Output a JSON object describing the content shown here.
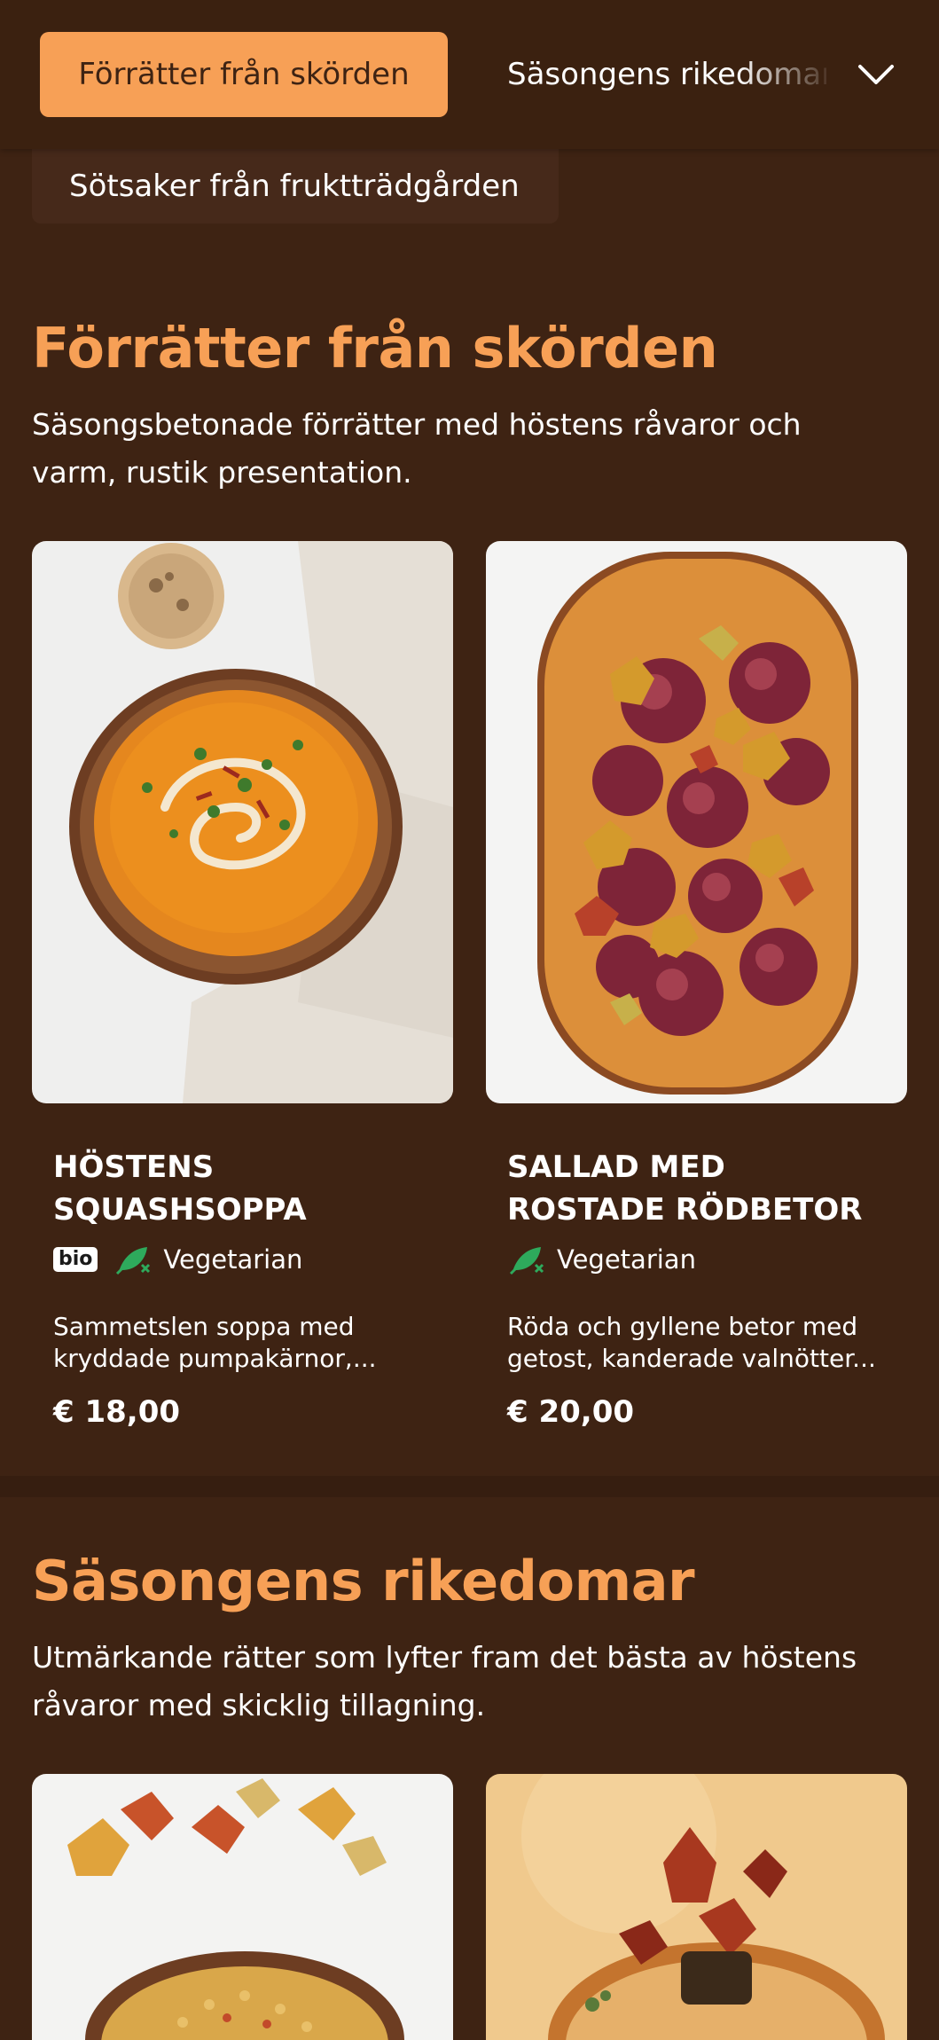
{
  "nav": {
    "active_tab": "Förrätter från skörden",
    "next_tab": "Säsongens rikedomar",
    "extra_chip": "Sötsaker från fruktträdgården"
  },
  "sections": [
    {
      "title": "Förrätter från skörden",
      "description": "Säsongsbetonade förrätter med höstens råvaror och varm, rustik presentation.",
      "items": [
        {
          "name": "HÖSTENS SQUASHSOPPA",
          "bio": "bio",
          "diet": "Vegetarian",
          "description": "Sammetslen soppa med kryddade pumpakärnor,...",
          "price": "€ 18,00"
        },
        {
          "name": "SALLAD MED ROSTADE RÖDBETOR",
          "diet": "Vegetarian",
          "description": "Röda och gyllene betor med getost, kanderade valnötter...",
          "price": "€ 20,00"
        }
      ]
    },
    {
      "title": "Säsongens rikedomar",
      "description": "Utmärkande rätter som lyfter fram det bästa av höstens råvaror med skicklig tillagning."
    }
  ],
  "colors": {
    "background": "#3e2313",
    "accent": "#f7a056",
    "vegetarian_icon": "#2eaa5c"
  },
  "icons": [
    "chevron-down-icon",
    "bio-badge",
    "vegetarian-leaf-icon"
  ]
}
